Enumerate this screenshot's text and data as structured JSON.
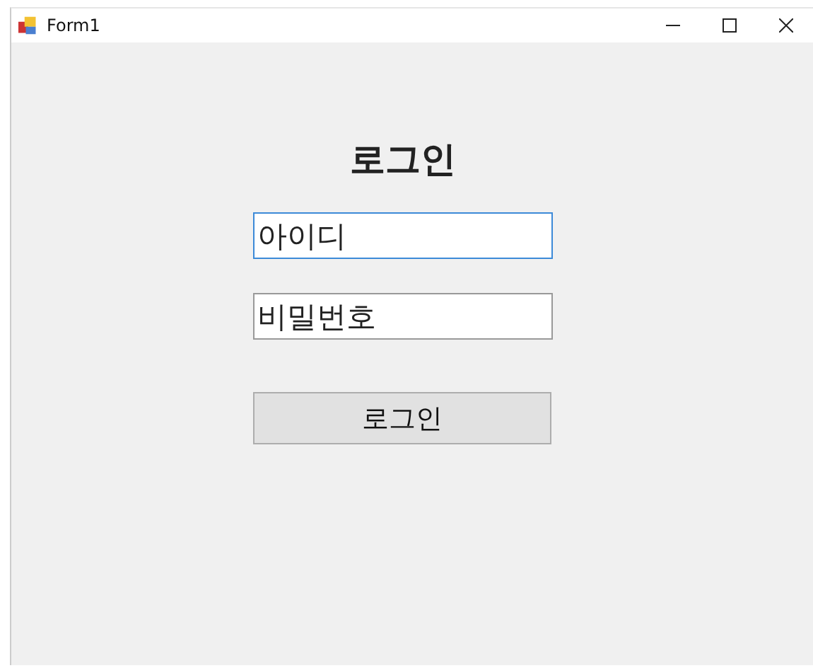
{
  "window": {
    "title": "Form1"
  },
  "heading": "로그인",
  "fields": [
    {
      "value": "아이디",
      "focused": true
    },
    {
      "value": "비밀번호",
      "focused": false
    }
  ],
  "button": "로그인"
}
